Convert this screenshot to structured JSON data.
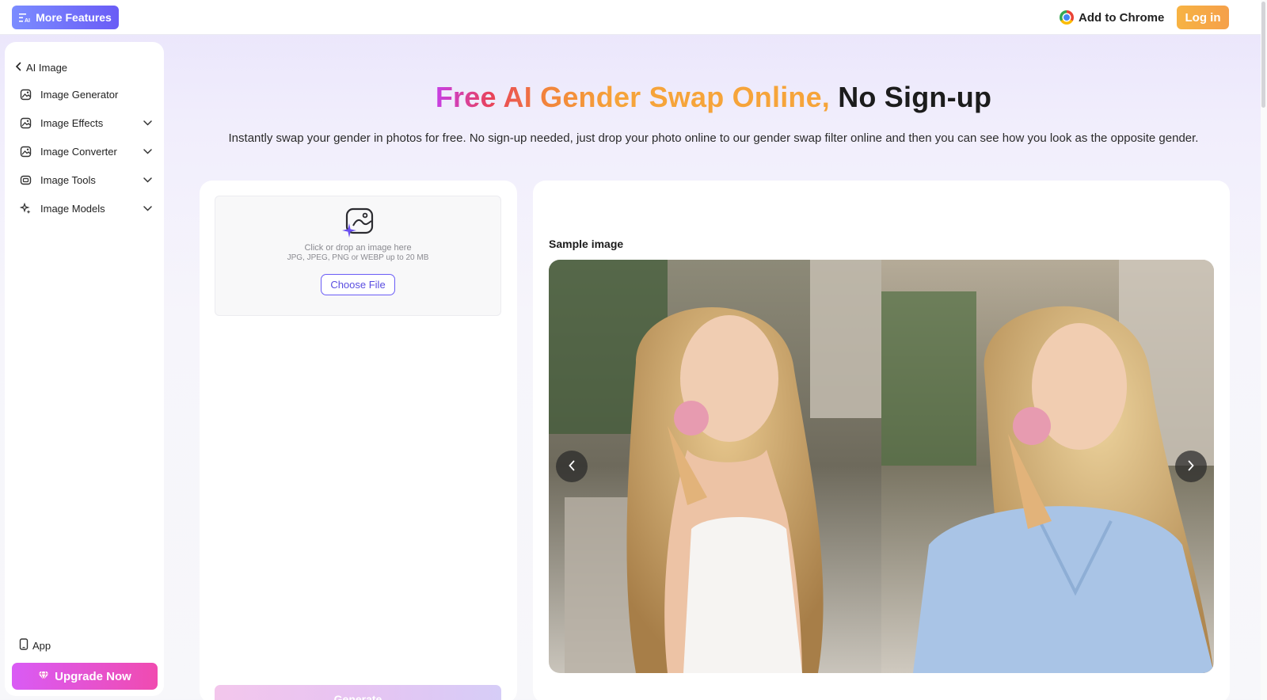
{
  "topbar": {
    "more_features": "More Features",
    "add_to_chrome": "Add to Chrome",
    "login": "Log in"
  },
  "sidebar": {
    "back": "AI Image",
    "items": [
      {
        "label": "Image Generator",
        "icon": "image-generator-icon",
        "expandable": false
      },
      {
        "label": "Image Effects",
        "icon": "image-effects-icon",
        "expandable": true
      },
      {
        "label": "Image Converter",
        "icon": "image-converter-icon",
        "expandable": true
      },
      {
        "label": "Image Tools",
        "icon": "image-tools-icon",
        "expandable": true
      },
      {
        "label": "Image Models",
        "icon": "image-models-icon",
        "expandable": true
      }
    ],
    "app": "App",
    "upgrade": "Upgrade Now"
  },
  "hero": {
    "title_colored": "Free AI Gender Swap Online,",
    "title_dark": "No Sign-up",
    "subtitle": "Instantly swap your gender in photos for free. No sign-up needed, just drop your photo online to our gender swap filter online and then you can see how you look as the opposite gender."
  },
  "upload": {
    "line1": "Click or drop an image here",
    "line2": "JPG, JPEG, PNG or WEBP up to 20 MB",
    "choose_file": "Choose File",
    "generate": "Generate"
  },
  "sample": {
    "label": "Sample image"
  },
  "colors": {
    "accent": "#6a5cf6",
    "login": "#f5a84a",
    "upgrade": "#e852c8"
  }
}
